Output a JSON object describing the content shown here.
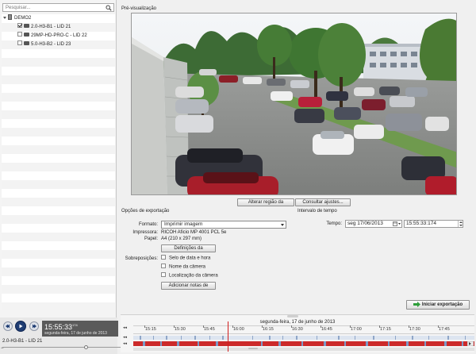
{
  "sidebar": {
    "search_placeholder": "Pesquisar...",
    "server": "DEMO2",
    "cameras": [
      {
        "label": "2.0-H3-B1 - LID 21",
        "checked": true
      },
      {
        "label": "29MP-HD-PRO-C - LID 22",
        "checked": false
      },
      {
        "label": "5.0-H3-B2 - LID 23",
        "checked": false
      }
    ]
  },
  "preview": {
    "title": "Pré-visualização",
    "adjust_region_button": "Alterar região da",
    "consult_adjust_button": "Consultar ajustes..."
  },
  "export_options": {
    "title": "Opções de exportação",
    "format_label": "Formato:",
    "format_value": "Imprimir imagem",
    "printer_label": "Impressora:",
    "printer_value": "RICOH Aficio MP 4001 PCL 5e",
    "paper_label": "Papel:",
    "paper_value": "A4 (210 x 297 mm)",
    "settings_button": "Definições da",
    "overlays_label": "Sobreposições:",
    "overlays": [
      {
        "label": "Selo de data e hora",
        "checked": false
      },
      {
        "label": "Nome da câmera",
        "checked": false
      },
      {
        "label": "Localização da câmera",
        "checked": false
      }
    ],
    "add_notes_button": "Adicionar notas de"
  },
  "interval": {
    "title": "Intervalo de tempo",
    "time_label": "Tempo:",
    "date_value": "seg 17/06/2013",
    "time_value": "15:55:33:174"
  },
  "export_button": "Iniciar exportação",
  "playback": {
    "clock_time": "15:55:33",
    "clock_ms": "174",
    "clock_date": "segunda-feira, 17 de junho de 2013",
    "camera_name": "2.0-H3-B1 - LID 21"
  },
  "timeline": {
    "date": "segunda-feira, 17 de junho de 2013",
    "ticks": [
      "15:15",
      "15:30",
      "15:45",
      "16:00",
      "16:15",
      "16:30",
      "16:45",
      "17:00",
      "17:15",
      "17:30",
      "17:45"
    ],
    "recording_color": "#cc2a2a",
    "cursor_color": "#d21d1d"
  },
  "colors": {
    "accent": "#1f3d73",
    "export_icon": "#2e9e3a"
  }
}
